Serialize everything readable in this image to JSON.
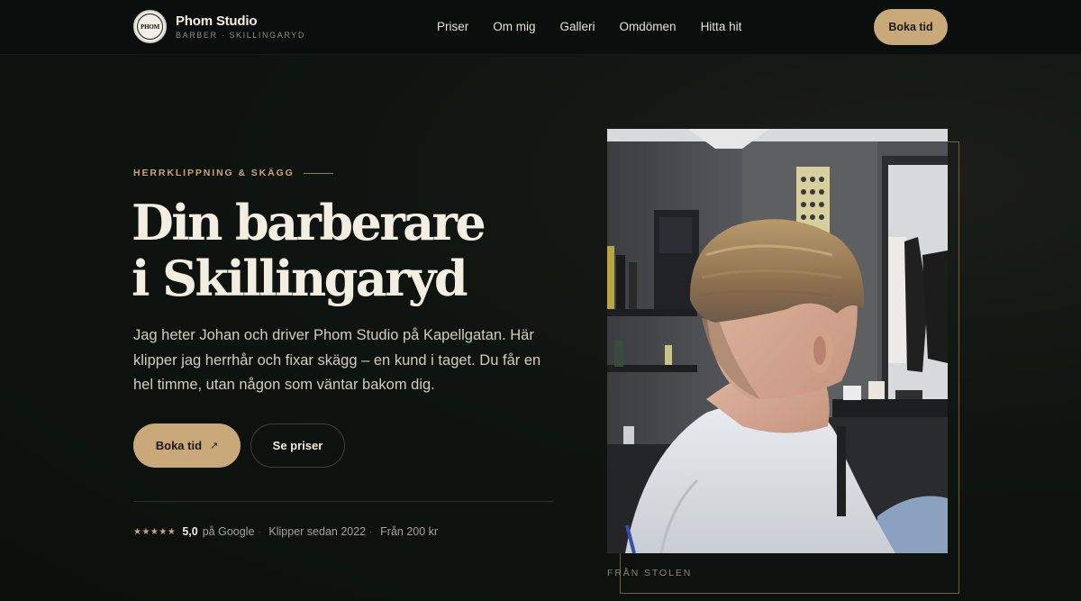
{
  "brand": {
    "name": "Phom Studio",
    "subtitle": "BARBER · SKILLINGARYD",
    "logo_text": "PHOM"
  },
  "nav": {
    "items": [
      "Priser",
      "Om mig",
      "Galleri",
      "Omdömen",
      "Hitta hit"
    ]
  },
  "header": {
    "cta_label": "Boka tid"
  },
  "hero": {
    "eyebrow": "HERRKLIPPNING & SKÄGG",
    "title_line1": "Din barberare",
    "title_line2": "i Skillingaryd",
    "lead": "Jag heter Johan och driver Phom Studio på Kapellgatan. Här klipper jag herrhår och fixar skägg – en kund i taget. Du får en hel timme, utan någon som väntar bakom dig.",
    "primary_cta": "Boka tid",
    "primary_cta_icon": "↗",
    "secondary_cta": "Se priser"
  },
  "stats": {
    "stars": "★★★★★",
    "rating": "5,0",
    "rating_source": "på Google",
    "separator": "·",
    "since": "Klipper sedan 2022",
    "price_from": "Från 200 kr"
  },
  "photo": {
    "caption": "FRÅN STOLEN"
  },
  "colors": {
    "accent": "#c9a979",
    "background": "#0d120f",
    "text": "#efe9dc"
  }
}
